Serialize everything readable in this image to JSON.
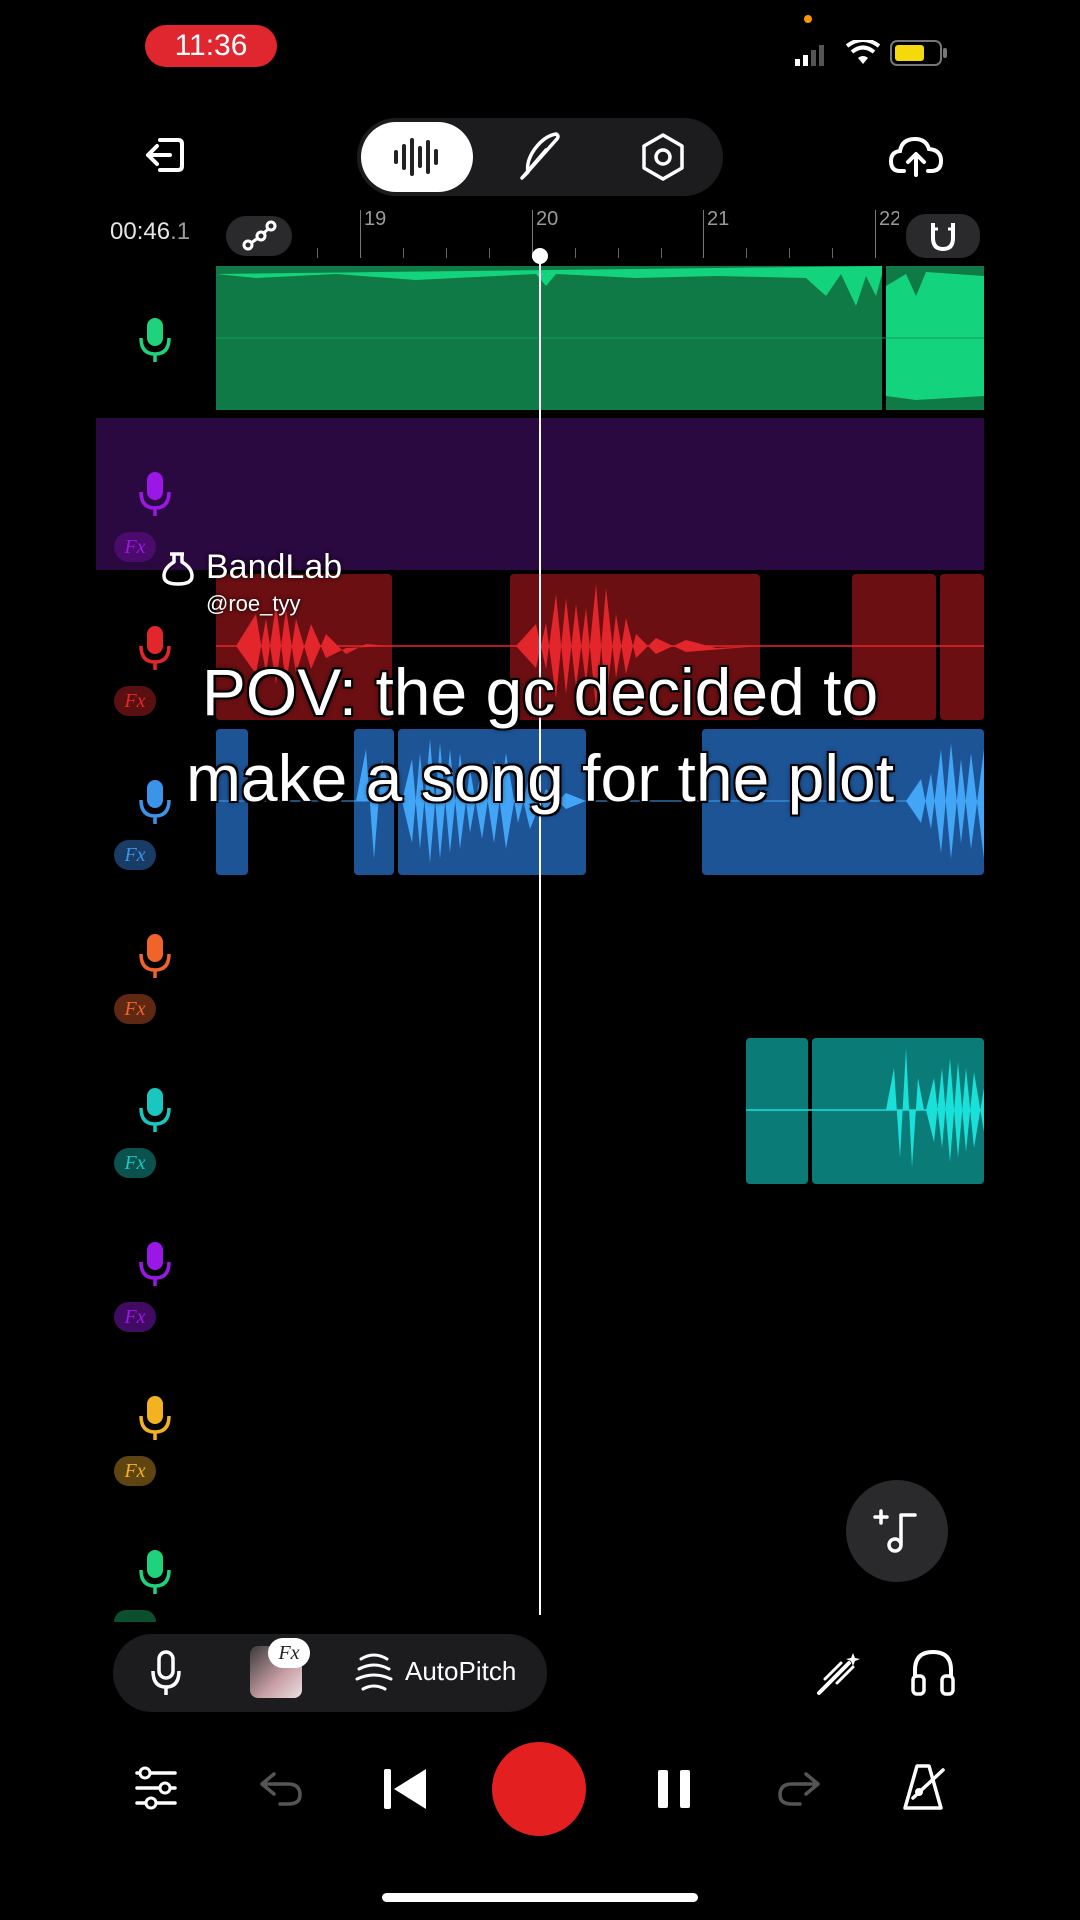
{
  "status_bar": {
    "time": "11:36"
  },
  "toolbar": {
    "tabs": [
      {
        "icon": "waveform-icon",
        "active": true
      },
      {
        "icon": "feather-icon",
        "active": false
      },
      {
        "icon": "hex-settings-icon",
        "active": false
      }
    ]
  },
  "ruler": {
    "timecode_main": "00:46",
    "timecode_frac": ".1",
    "markers": [
      "19",
      "20",
      "21",
      "22"
    ]
  },
  "tracks": [
    {
      "color": "#1ed37c",
      "fx": false
    },
    {
      "color": "#9b17e6",
      "fx": true
    },
    {
      "color": "#e3262b",
      "fx": true
    },
    {
      "color": "#3c94e8",
      "fx": true
    },
    {
      "color": "#f0642a",
      "fx": true
    },
    {
      "color": "#19c6c0",
      "fx": true
    },
    {
      "color": "#9b17e6",
      "fx": true
    },
    {
      "color": "#f3b21f",
      "fx": true
    },
    {
      "color": "#1ed37c",
      "fx": true
    }
  ],
  "fx_label": "Fx",
  "watermark": {
    "brand": "BandLab",
    "user": "@roe_tyy"
  },
  "caption": {
    "line1": "POV: the gc decided to",
    "line2": "make a song for the plot"
  },
  "bottom_toolbar": {
    "fx_label": "Fx",
    "autopitch_label": "AutoPitch"
  },
  "transport": {
    "record_color": "#e3201f"
  }
}
